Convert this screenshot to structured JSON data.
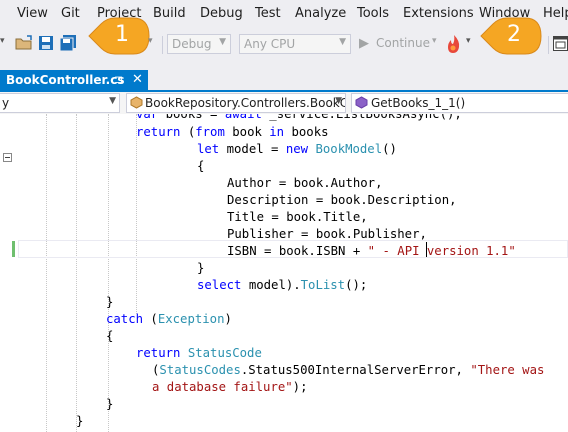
{
  "menu": [
    "View",
    "Git",
    "Project",
    "Build",
    "Debug",
    "Test",
    "Analyze",
    "Tools",
    "Extensions",
    "Window",
    "Help"
  ],
  "toolbar": {
    "config": "Debug",
    "platform": "Any CPU",
    "continue_label": "Continue",
    "continue_arrow": "▾"
  },
  "callouts": [
    "1",
    "2"
  ],
  "tab": {
    "title": "BookController.cs",
    "pin": "⊐",
    "close": "✕"
  },
  "navbar": {
    "project": "y",
    "class": "BookRepository.Controllers.BookCo",
    "member": "GetBooks_1_1()"
  },
  "code_lines": [
    "        var books = await _service.ListBooksAsync();",
    "        return (from book in books",
    "                let model = new BookModel()",
    "                {",
    "                    Author = book.Author,",
    "                    Description = book.Description,",
    "                    Title = book.Title,",
    "                    Publisher = book.Publisher,",
    "                    ISBN = book.ISBN + \" - API version 1.1\"",
    "                }",
    "                select model).ToList();",
    "    }",
    "    catch (Exception)",
    "    {",
    "        return StatusCode",
    "          (StatusCodes.Status500InternalServerError, \"There was",
    "          a database failure\");",
    "    }",
    "}"
  ],
  "colors": {
    "accent": "#007acc",
    "callout": "#f5a623",
    "keyword": "#0000ff",
    "type": "#2b91af",
    "string": "#a31515"
  }
}
